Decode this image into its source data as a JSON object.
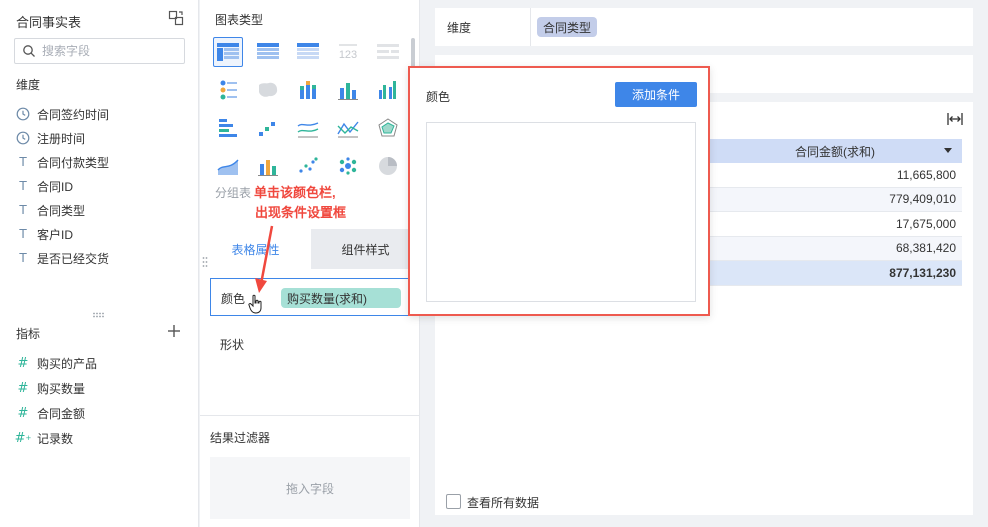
{
  "data_panel": {
    "title": "合同事实表",
    "search": {
      "placeholder": "搜索字段",
      "value": ""
    },
    "dimension_label": "维度",
    "dimensions": [
      {
        "icon": "clock-icon",
        "label": "合同签约时间"
      },
      {
        "icon": "clock-icon",
        "label": "注册时间"
      },
      {
        "icon": "text-type-icon",
        "label": "合同付款类型"
      },
      {
        "icon": "text-type-icon",
        "label": "合同ID"
      },
      {
        "icon": "text-type-icon",
        "label": "合同类型"
      },
      {
        "icon": "text-type-icon",
        "label": "客户ID"
      },
      {
        "icon": "text-type-icon",
        "label": "是否已经交货"
      }
    ],
    "metric_label": "指标",
    "metrics": [
      {
        "icon": "hash-icon",
        "label": "购买的产品"
      },
      {
        "icon": "hash-icon",
        "label": "购买数量"
      },
      {
        "icon": "hash-icon",
        "label": "合同金额"
      },
      {
        "icon": "record-count-icon",
        "label": "记录数"
      }
    ]
  },
  "config_panel": {
    "chart_type_label": "图表类型",
    "grouping_table_label": "分组表",
    "tabs": [
      {
        "label": "表格属性"
      },
      {
        "label": "组件样式"
      }
    ],
    "color_label": "颜色",
    "color_field": "购买数量(求和)",
    "shape_label": "形状",
    "result_filter_label": "结果过滤器",
    "drop_placeholder": "拖入字段"
  },
  "annotation": {
    "line1": "单击该颜色栏,",
    "line2": "出现条件设置框"
  },
  "canvas": {
    "dimension_label": "维度",
    "dimension_field": "合同类型",
    "table": {
      "header": "合同金额(求和)",
      "rows": [
        "11,665,800",
        "779,409,010",
        "17,675,000",
        "68,381,420"
      ],
      "total": "877,131,230"
    },
    "show_all_label": "查看所有数据"
  },
  "popup": {
    "title": "颜色",
    "add_button": "添加条件"
  },
  "colors": {
    "accent": "#3e86e8",
    "annotation_red": "#f0483e",
    "metric_pill": "#a6e0d6",
    "dimension_pill": "#c3cde9"
  }
}
